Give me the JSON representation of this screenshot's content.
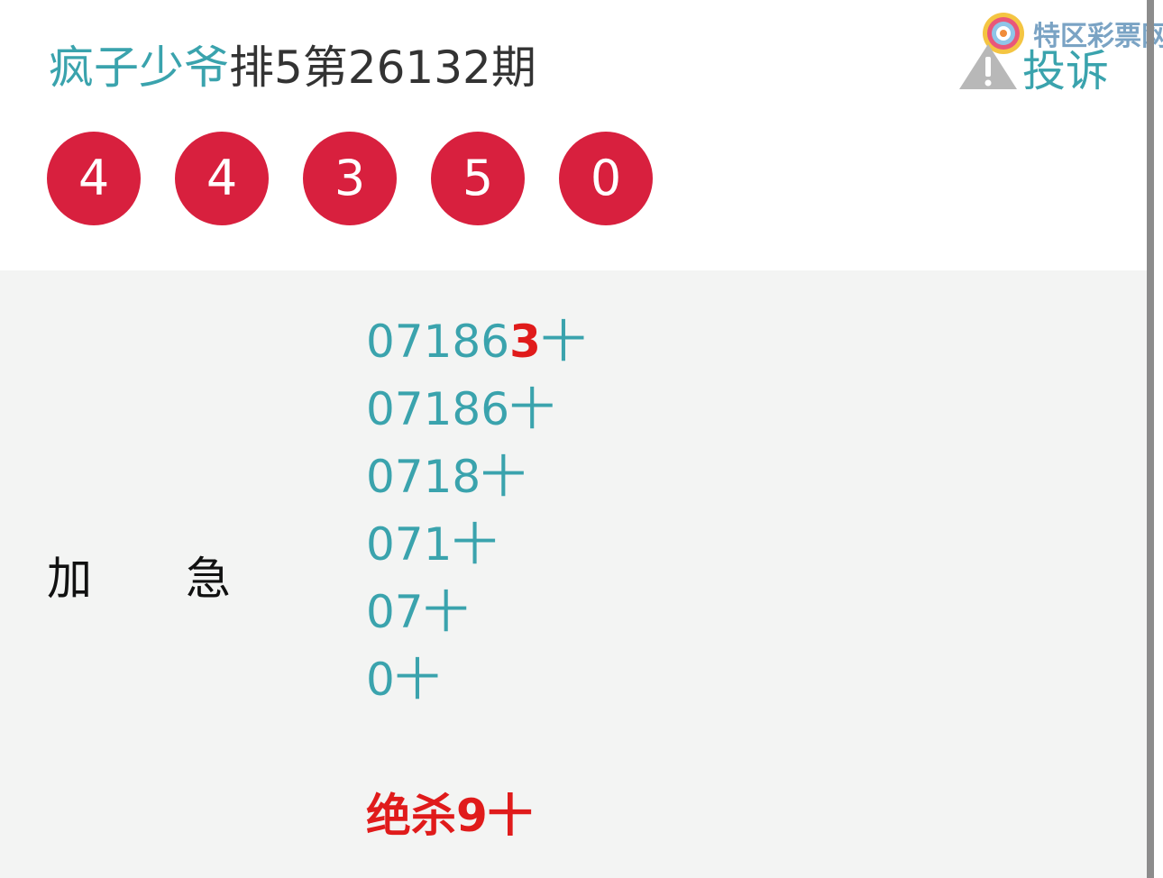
{
  "header": {
    "author": "疯子少爷",
    "issue": "排5第26132期",
    "watermark": "特区彩票网",
    "complain_label": "投诉"
  },
  "draw": {
    "balls": [
      "4",
      "4",
      "3",
      "5",
      "0"
    ]
  },
  "tags": [
    "加",
    "急"
  ],
  "tens_lines": [
    {
      "base": "07186",
      "highlight": "3",
      "suffix": "十"
    },
    {
      "base": "07186",
      "highlight": "",
      "suffix": "十"
    },
    {
      "base": "0718",
      "highlight": "",
      "suffix": "十"
    },
    {
      "base": "071",
      "highlight": "",
      "suffix": "十"
    },
    {
      "base": "07",
      "highlight": "",
      "suffix": "十"
    },
    {
      "base": "0",
      "highlight": "",
      "suffix": "十"
    }
  ],
  "kill_line": "绝杀9十",
  "colors": {
    "accent_teal": "#3aa3ad",
    "ball_red": "#d8203e",
    "highlight_red": "#e01b1b",
    "panel_bg": "#f3f4f3"
  }
}
